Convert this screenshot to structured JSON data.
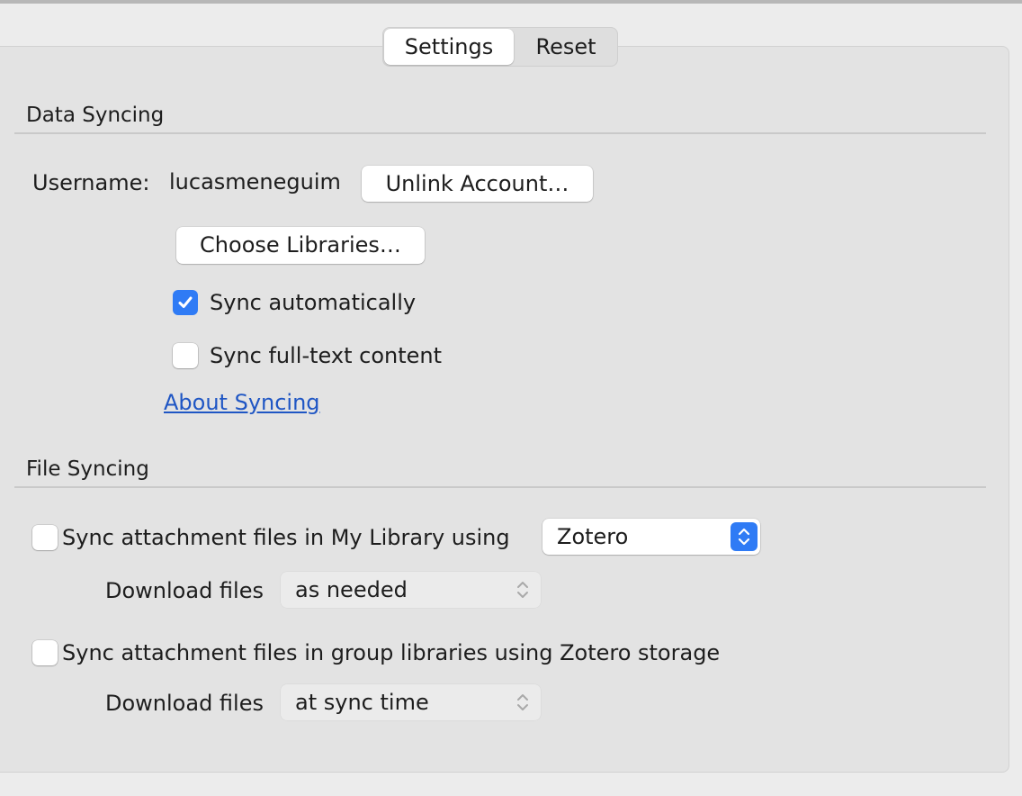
{
  "tabs": {
    "settings": "Settings",
    "reset": "Reset"
  },
  "data_syncing": {
    "title": "Data Syncing",
    "username_label": "Username:",
    "username_value": "lucasmeneguim",
    "unlink_button": "Unlink Account…",
    "choose_libraries_button": "Choose Libraries…",
    "sync_automatically": {
      "label": "Sync automatically",
      "checked": true
    },
    "sync_fulltext": {
      "label": "Sync full-text content",
      "checked": false
    },
    "about_link": "About Syncing"
  },
  "file_syncing": {
    "title": "File Syncing",
    "my_library": {
      "label": "Sync attachment files in My Library using",
      "checked": false,
      "method": "Zotero",
      "download_label": "Download files",
      "download_value": "as needed"
    },
    "group_libraries": {
      "label": "Sync attachment files in group libraries using Zotero storage",
      "checked": false,
      "download_label": "Download files",
      "download_value": "at sync time"
    }
  },
  "colors": {
    "accent": "#2f7bf5",
    "link": "#1f56c4"
  }
}
